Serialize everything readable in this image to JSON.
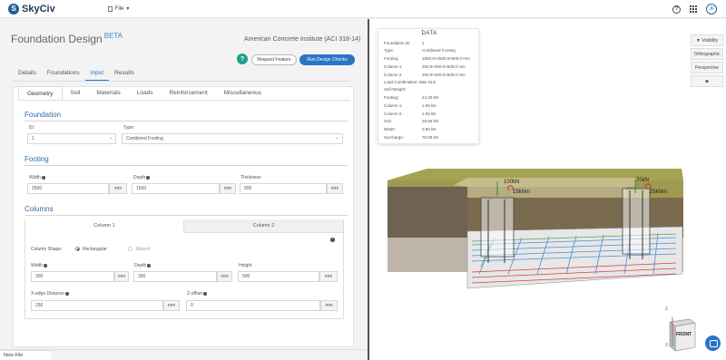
{
  "app": {
    "logo_text": "SkyCiv",
    "logo_mark": "S",
    "file_name": "File",
    "avatar_initials": "JF",
    "help_label": "?"
  },
  "header": {
    "title": "Foundation Design",
    "beta": "BETA",
    "design_code": "American Concrete Institute (ACI 318-14)",
    "round_btn": "?",
    "request_feature": "Request Feature",
    "run_checks": "Run Design Checks"
  },
  "main_tabs": [
    "Details",
    "Foundations",
    "Input",
    "Results"
  ],
  "sub_tabs": [
    "Geometry",
    "Soil",
    "Materials",
    "Loads",
    "Reinforcement",
    "Miscellaneous"
  ],
  "foundation": {
    "heading": "Foundation",
    "id_label": "ID:",
    "id_value": "1",
    "type_label": "Type:",
    "type_value": "Combined Footing"
  },
  "footing": {
    "heading": "Footing",
    "width_label": "Width",
    "width_value": "2500",
    "depth_label": "Depth",
    "depth_value": "1500",
    "thickness_label": "Thickness",
    "thickness_value": "500",
    "unit": "mm"
  },
  "columns": {
    "heading": "Columns",
    "tab1": "Column 1",
    "tab2": "Column 2",
    "shape_label": "Column Shape:",
    "rect_label": "Rectangular",
    "round_label": "Round",
    "width_label": "Width",
    "width_value": "300",
    "depth_label": "Depth",
    "depth_value": "300",
    "height_label": "Height",
    "height_value": "500",
    "xedge_label": "X-edge Distance",
    "xedge_value": "250",
    "zoffset_label": "Z-offset",
    "zoffset_value": "0",
    "unit": "mm",
    "info_glyph": "i"
  },
  "footer": {
    "new_file": "New File"
  },
  "data_panel": {
    "title": "DATA",
    "rows": [
      {
        "k": "Foundation ID:",
        "v": "1"
      },
      {
        "k": "Type:",
        "v": "Combined Footing"
      },
      {
        "k": "Footing:",
        "v": "1500.0×2500.0×500.0 mm"
      },
      {
        "k": "Column 1:",
        "v": "300.0×300.0×500.0 mm"
      },
      {
        "k": "Column 2:",
        "v": "300.0×300.0×500.0 mm"
      },
      {
        "k": "Load Combination: Max SLS",
        "v": ""
      },
      {
        "k": "Self-Weight:",
        "v": ""
      },
      {
        "k": "Footing:",
        "v": "44.25 kN"
      },
      {
        "k": "Column 1:",
        "v": "1.06 kN"
      },
      {
        "k": "Column 2:",
        "v": "1.06 kN"
      },
      {
        "k": "Soil:",
        "v": "29.56 kN"
      },
      {
        "k": "Water:",
        "v": "0.00 kN"
      },
      {
        "k": "Surcharge:",
        "v": "75.00 kN"
      }
    ]
  },
  "view_controls": {
    "visibility": "Visibility",
    "orthographic": "Orthographic",
    "perspective": "Perspective",
    "camera": "camera-icon"
  },
  "model_labels": {
    "load1": "100kN",
    "moment1": "15kNm",
    "load2": "70kN",
    "moment2": "25kNm",
    "cube_face": "FRONT",
    "axis_z": "Z",
    "axis_x": "X"
  },
  "colors": {
    "accent": "#2a74c7",
    "section": "#2d6fa8",
    "green_btn": "#20a08a"
  }
}
